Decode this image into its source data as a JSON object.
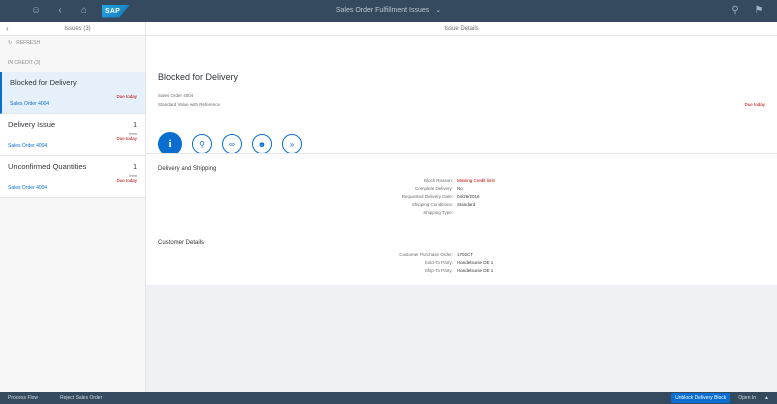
{
  "shell": {
    "title": "Sales Order Fulfillment Issues",
    "icons": [
      "user-icon",
      "back-icon",
      "home-icon",
      "search-icon",
      "flag-icon"
    ]
  },
  "master": {
    "header_title": "Issues (3)",
    "refresh_label": "REFRESH",
    "group_label": "IN CREDIT (3)",
    "items": [
      {
        "title": "Blocked for Delivery",
        "qty": "",
        "unit": "",
        "due": "Due today",
        "so": "Sales Order 4004"
      },
      {
        "title": "Delivery Issue",
        "qty": "1",
        "unit": "Item",
        "due": "Due today",
        "so": "Sales Order 4004"
      },
      {
        "title": "Unconfirmed Quantities",
        "qty": "1",
        "unit": "Item",
        "due": "Due today",
        "so": "Sales Order 4004"
      }
    ]
  },
  "detail": {
    "header_title": "Issue Details",
    "object_title": "Blocked for Delivery",
    "sub1": "Sales Order 4004",
    "sub2": "Standard Value with Reference",
    "due": "Due today",
    "sections": [
      {
        "title": "Delivery and Shipping",
        "rows": [
          {
            "k": "Block Reason:",
            "v": "Missing Credit limit",
            "red": true
          },
          {
            "k": "Complete Delivery:",
            "v": "No",
            "red": false
          },
          {
            "k": "Requested Delivery Date:",
            "v": "04/26/2016",
            "red": false
          },
          {
            "k": "Shipping Conditions:",
            "v": "Standard",
            "red": false
          },
          {
            "k": "Shipping Type:",
            "v": "",
            "red": false
          }
        ]
      },
      {
        "title": "Customer Details",
        "rows": [
          {
            "k": "Customer Purchase Order:",
            "v": "1702CT",
            "red": false
          },
          {
            "k": "Sold-To Party:",
            "v": "Handelsunie DE 1",
            "red": false
          },
          {
            "k": "Ship-To Party:",
            "v": "Handelsunie DE 1",
            "red": false
          }
        ]
      }
    ]
  },
  "footer": {
    "left1": "Process Flow",
    "left2": "Reject Sales Order",
    "primary_btn": "Unblock Delivery Block",
    "open_in": "Open In",
    "colors": {
      "shell": "#354a5f",
      "accent": "#0a6ed1",
      "negative": "#bb0000"
    }
  }
}
